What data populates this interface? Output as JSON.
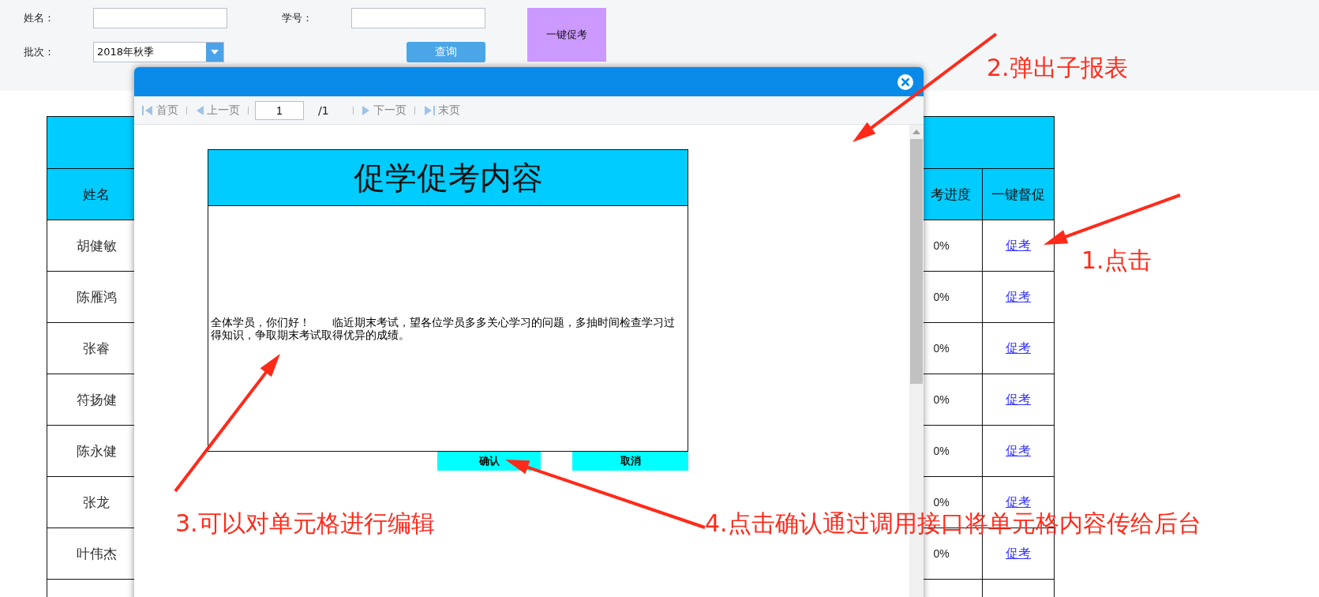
{
  "filters": {
    "name_label": "姓名：",
    "student_id_label": "学号：",
    "batch_label": "批次：",
    "batch_value": "2018年秋季",
    "query_button": "查询",
    "promote_all_button": "一键促考"
  },
  "table": {
    "columns": [
      "姓名",
      "考进度",
      "一键督促"
    ],
    "rows": [
      {
        "name": "胡健敏",
        "progress": "0%",
        "action": "促考"
      },
      {
        "name": "陈雁鸿",
        "progress": "0%",
        "action": "促考"
      },
      {
        "name": "张睿",
        "progress": "0%",
        "action": "促考"
      },
      {
        "name": "符扬健",
        "progress": "0%",
        "action": "促考"
      },
      {
        "name": "陈永健",
        "progress": "0%",
        "action": "促考"
      },
      {
        "name": "张龙",
        "progress": "0%",
        "action": "促考"
      },
      {
        "name": "叶伟杰",
        "progress": "0%",
        "action": "促考"
      }
    ]
  },
  "dialog": {
    "pager": {
      "first": "首页",
      "prev": "上一页",
      "page": "1",
      "total": "/1",
      "next": "下一页",
      "last": "末页"
    },
    "report": {
      "title": "促学促考内容",
      "content": "全体学员，你们好！　　临近期末考试，望各位学员多多关心学习的问题，多抽时间检查学习过得知识，争取期末考试取得优异的成绩。",
      "buttons": [
        "确认",
        "取消"
      ]
    }
  },
  "annotations": [
    "2.弹出子报表",
    "1.点击",
    "3.可以对单元格进行编辑",
    "4.点击确认通过调用接口将单元格内容传给后台"
  ]
}
